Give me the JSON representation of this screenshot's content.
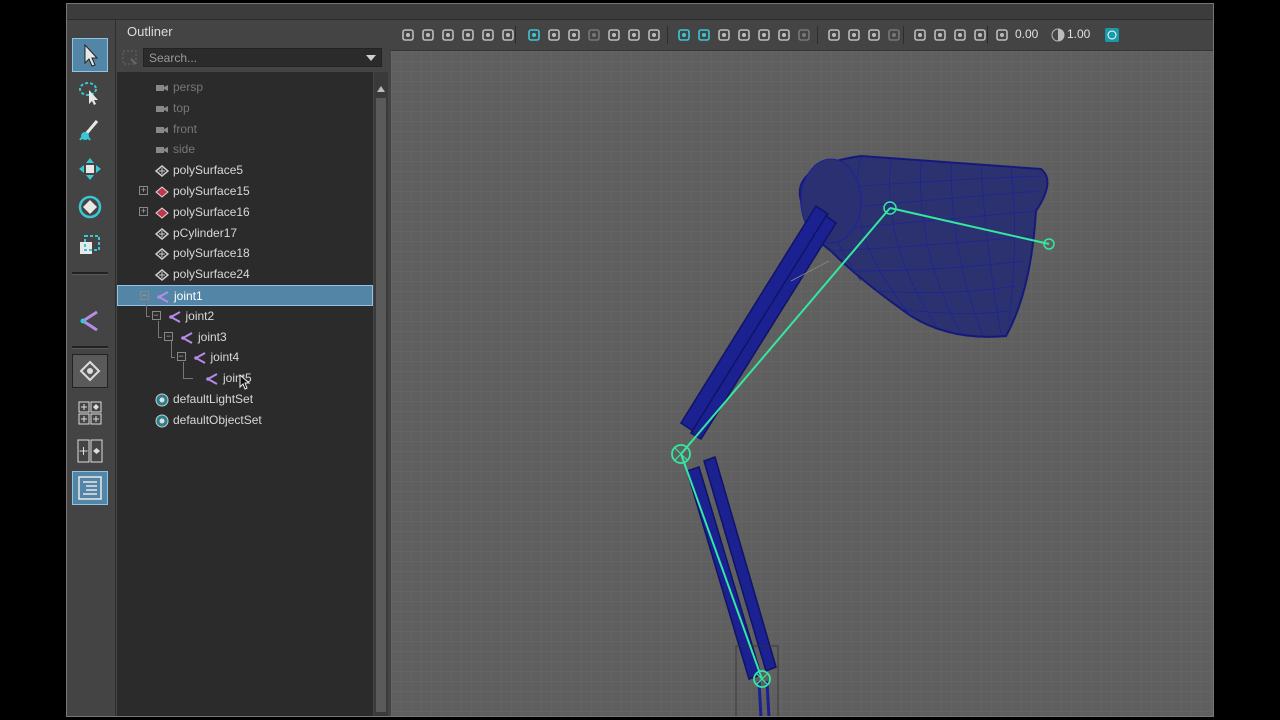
{
  "outliner": {
    "title": "Outliner",
    "search_placeholder": "Search...",
    "items": [
      {
        "label": "persp",
        "type": "camera",
        "dimmed": true,
        "depth": 0
      },
      {
        "label": "top",
        "type": "camera",
        "dimmed": true,
        "depth": 0
      },
      {
        "label": "front",
        "type": "camera",
        "dimmed": true,
        "depth": 0
      },
      {
        "label": "side",
        "type": "camera",
        "dimmed": true,
        "depth": 0
      },
      {
        "label": "polySurface5",
        "type": "mesh",
        "depth": 0
      },
      {
        "label": "polySurface15",
        "type": "mesh-group",
        "expand": "+",
        "depth": 0
      },
      {
        "label": "polySurface16",
        "type": "mesh-group",
        "expand": "+",
        "depth": 0
      },
      {
        "label": "pCylinder17",
        "type": "mesh",
        "depth": 0
      },
      {
        "label": "polySurface18",
        "type": "mesh",
        "depth": 0
      },
      {
        "label": "polySurface24",
        "type": "mesh",
        "depth": 0
      },
      {
        "label": "joint1",
        "type": "joint",
        "expand": "-",
        "selected": true,
        "depth": 0
      },
      {
        "label": "joint2",
        "type": "joint",
        "expand": "-",
        "depth": 1
      },
      {
        "label": "joint3",
        "type": "joint",
        "expand": "-",
        "depth": 2
      },
      {
        "label": "joint4",
        "type": "joint",
        "expand": "-",
        "depth": 3
      },
      {
        "label": "joint5",
        "type": "joint",
        "depth": 4
      },
      {
        "label": "defaultLightSet",
        "type": "set",
        "depth": 0
      },
      {
        "label": "defaultObjectSet",
        "type": "set",
        "depth": 0
      }
    ]
  },
  "toolbox": {
    "tools": [
      "select-tool-icon",
      "lasso-tool-icon",
      "paint-select-tool-icon",
      "move-tool-icon",
      "rotate-tool-icon",
      "scale-tool-icon",
      "joint-tool-icon",
      "single-perspective-layout-icon",
      "four-view-layout-icon",
      "two-pane-layout-icon",
      "outliner-layout-icon"
    ]
  },
  "viewport_toolbar": {
    "exposure_value": "0.00",
    "gamma_value": "1.00"
  },
  "colors": {
    "selection": "#5285a6",
    "joint": "#33e8a0",
    "wireframe": "#14197a",
    "grid_bg": "#5f5f5f"
  }
}
